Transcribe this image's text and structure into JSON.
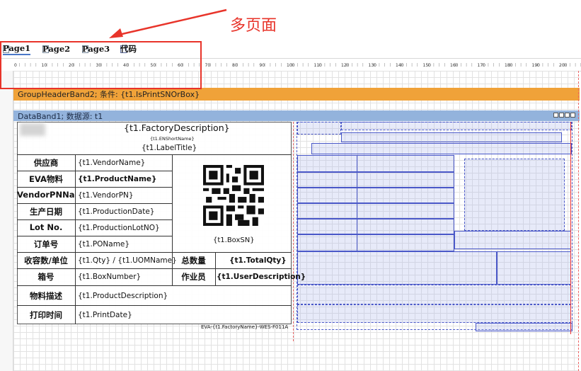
{
  "annotation": {
    "text": "多页面"
  },
  "tabs": [
    {
      "label": "Page1",
      "active": true
    },
    {
      "label": "Page2",
      "active": false
    },
    {
      "label": "Page3",
      "active": false
    },
    {
      "label": "代码",
      "active": false
    }
  ],
  "ruler": {
    "ticks": [
      "0",
      "10",
      "20",
      "30",
      "40",
      "50",
      "60",
      "70",
      "80",
      "90",
      "100",
      "110",
      "120",
      "130",
      "140",
      "150",
      "160",
      "170",
      "180",
      "190",
      "200"
    ]
  },
  "bands": {
    "group_header": "GroupHeaderBand2; 条件: {t1.IsPrintSNOrBox}",
    "data_band": "DataBand1; 数据源: t1"
  },
  "report": {
    "factory_description": "{t1.FactoryDescription}",
    "en_short_name": "{t1.ENShortName}",
    "label_title": "{t1.LabelTitle}",
    "box_sn": "{t1.BoxSN}",
    "footer": "EVA-{t1.FactoryName}-WES-F011A",
    "rows": [
      {
        "label": "供应商",
        "value": "{t1.VendorName}",
        "bold": false
      },
      {
        "label": "EVA物料",
        "value": "{t1.ProductName}",
        "bold": true
      },
      {
        "label": "VendorPNNa",
        "value": "{t1.VendorPN}",
        "bold": false
      },
      {
        "label": "生产日期",
        "value": "{t1.ProductionDate}",
        "bold": false
      },
      {
        "label": "Lot No.",
        "value": "{t1.ProductionLotNO}",
        "bold": false
      },
      {
        "label": "订单号",
        "value": "{t1.POName}",
        "bold": false
      }
    ],
    "qty_row": {
      "label": "收容数/单位",
      "value": "{t1.Qty} / {t1.UOMName}",
      "total_label": "总数量",
      "total_value": "{t1.TotalQty}"
    },
    "box_row": {
      "label": "箱号",
      "value": "{t1.BoxNumber}",
      "operator_label": "作业员",
      "operator_value": "{t1.UserDescription}"
    },
    "desc_row": {
      "label": "物料描述",
      "value": "{t1.ProductDescription}"
    },
    "print_row": {
      "label": "打印时间",
      "value": "{t1.PrintDate}"
    }
  },
  "colors": {
    "group_header_bg": "#f0a239",
    "data_band_bg": "#93b3dc",
    "annotation_red": "#e8342a",
    "field_border": "#4a58c8"
  }
}
